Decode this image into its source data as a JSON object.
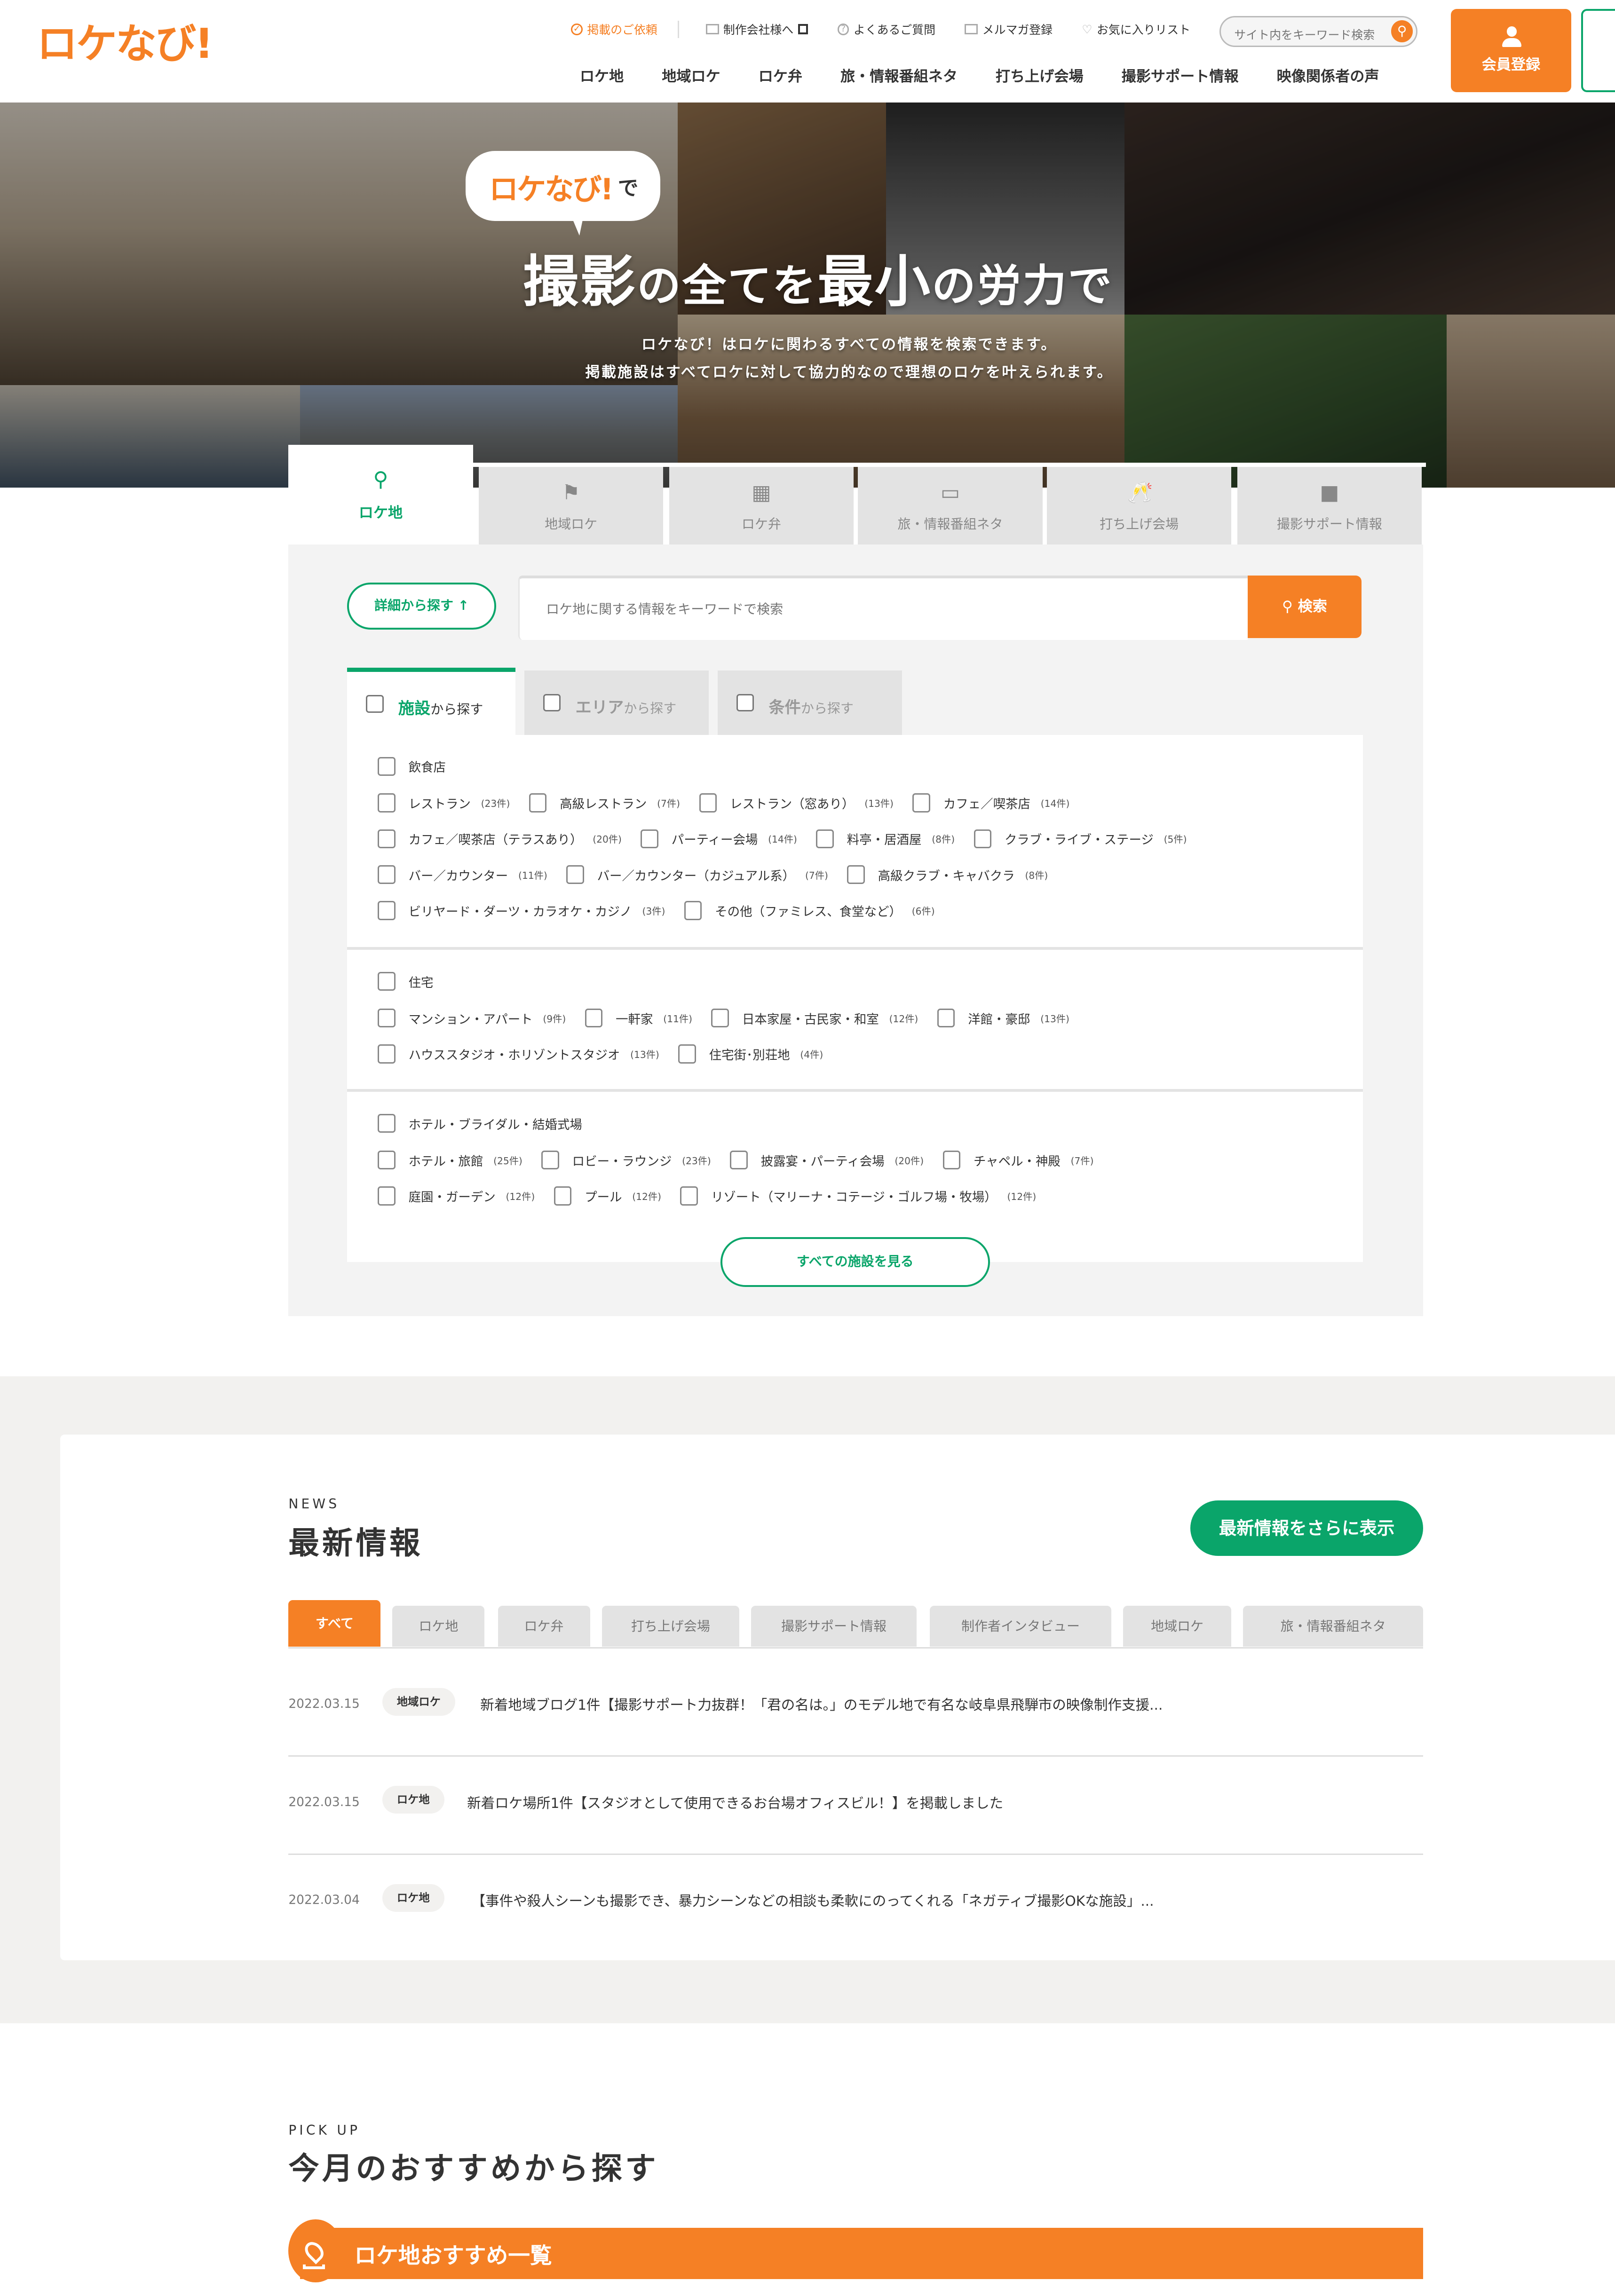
{
  "header": {
    "logo": "ロケなび!",
    "utility_links": [
      {
        "label": "掲載のご依頼",
        "icon": "check-circle-icon",
        "highlight": true
      },
      {
        "label": "制作会社様へ",
        "icon": "video-camera-icon",
        "external": true
      },
      {
        "label": "よくあるご質問",
        "icon": "question-circle-icon"
      },
      {
        "label": "メルマガ登録",
        "icon": "mail-icon"
      },
      {
        "label": "お気に入りリスト",
        "icon": "heart-icon"
      }
    ],
    "search_placeholder": "サイト内をキーワード検索",
    "main_nav": [
      "ロケ地",
      "地域ロケ",
      "ロケ弁",
      "旅・情報番組ネタ",
      "打ち上げ会場",
      "撮影サポート情報",
      "映像関係者の声"
    ],
    "register_label": "会員登録"
  },
  "hero": {
    "bubble_logo": "ロケなび!",
    "bubble_suffix": "で",
    "title_parts": [
      "撮影",
      "の全てを",
      "最小",
      "の労力で"
    ],
    "subtitle_lines": [
      "ロケなび！はロケに関わるすべての情報を検索できます。",
      "掲載施設はすべてロケに対して協力的なので理想のロケを叶えられます。"
    ]
  },
  "category_tabs": [
    {
      "label": "ロケ地",
      "icon": "map-pin-icon",
      "active": true
    },
    {
      "label": "地域ロケ",
      "icon": "map-flag-icon"
    },
    {
      "label": "ロケ弁",
      "icon": "bento-icon"
    },
    {
      "label": "旅・情報番組ネタ",
      "icon": "tv-icon"
    },
    {
      "label": "打ち上げ会場",
      "icon": "cheers-icon"
    },
    {
      "label": "撮影サポート情報",
      "icon": "video-camera-icon"
    }
  ],
  "search": {
    "detail_button": "詳細から探す ↑",
    "keyword_placeholder": "ロケ地に関する情報をキーワードで検索",
    "search_button": "検索",
    "sub_tabs": [
      {
        "accent": "施設",
        "rest": "から探す",
        "active": true
      },
      {
        "accent": "エリア",
        "rest": "から探す"
      },
      {
        "accent": "条件",
        "rest": "から探す"
      }
    ],
    "groups": [
      {
        "title": "飲食店",
        "rows": [
          [
            {
              "label": "レストラン",
              "count": "(23件)"
            },
            {
              "label": "高級レストラン",
              "count": "(7件)"
            },
            {
              "label": "レストラン（窓あり）",
              "count": "(13件)"
            },
            {
              "label": "カフェ／喫茶店",
              "count": "(14件)"
            }
          ],
          [
            {
              "label": "カフェ／喫茶店（テラスあり）",
              "count": "(20件)"
            },
            {
              "label": "パーティー会場",
              "count": "(14件)"
            },
            {
              "label": "料亭・居酒屋",
              "count": "(8件)"
            },
            {
              "label": "クラブ・ライブ・ステージ",
              "count": "(5件)"
            }
          ],
          [
            {
              "label": "バー／カウンター",
              "count": "(11件)"
            },
            {
              "label": "バー／カウンター（カジュアル系）",
              "count": "(7件)"
            },
            {
              "label": "高級クラブ・キャバクラ",
              "count": "(8件)"
            }
          ],
          [
            {
              "label": "ビリヤード・ダーツ・カラオケ・カジノ",
              "count": "(3件)"
            },
            {
              "label": "その他（ファミレス、食堂など）",
              "count": "(6件)"
            }
          ]
        ]
      },
      {
        "title": "住宅",
        "rows": [
          [
            {
              "label": "マンション・アパート",
              "count": "(9件)"
            },
            {
              "label": "一軒家",
              "count": "(11件)"
            },
            {
              "label": "日本家屋・古民家・和室",
              "count": "(12件)"
            },
            {
              "label": "洋館・豪邸",
              "count": "(13件)"
            }
          ],
          [
            {
              "label": "ハウススタジオ・ホリゾントスタジオ",
              "count": "(13件)"
            },
            {
              "label": "住宅街･別荘地",
              "count": "(4件)"
            }
          ]
        ]
      },
      {
        "title": "ホテル・ブライダル・結婚式場",
        "rows": [
          [
            {
              "label": "ホテル・旅館",
              "count": "(25件)"
            },
            {
              "label": "ロビー・ラウンジ",
              "count": "(23件)"
            },
            {
              "label": "披露宴・パーティ会場",
              "count": "(20件)"
            },
            {
              "label": "チャペル・神殿",
              "count": "(7件)"
            }
          ],
          [
            {
              "label": "庭園・ガーデン",
              "count": "(12件)"
            },
            {
              "label": "プール",
              "count": "(12件)"
            },
            {
              "label": "リゾート（マリーナ・コテージ・ゴルフ場・牧場）",
              "count": "(12件)"
            }
          ]
        ]
      }
    ],
    "all_button": "すべての施設を見る"
  },
  "news": {
    "eyebrow": "NEWS",
    "title": "最新情報",
    "more_button": "最新情報をさらに表示",
    "tabs": [
      "すべて",
      "ロケ地",
      "ロケ弁",
      "打ち上げ会場",
      "撮影サポート情報",
      "制作者インタビュー",
      "地域ロケ",
      "旅・情報番組ネタ"
    ],
    "items": [
      {
        "date": "2022.03.15",
        "category": "地域ロケ",
        "title": "新着地域ブログ1件【撮影サポート力抜群！「君の名は。」のモデル地で有名な岐阜県飛騨市の映像制作支援..."
      },
      {
        "date": "2022.03.15",
        "category": "ロケ地",
        "title": "新着ロケ場所1件【スタジオとして使用できるお台場オフィスビル！】を掲載しました"
      },
      {
        "date": "2022.03.04",
        "category": "ロケ地",
        "title": "【事件や殺人シーンも撮影でき、暴力シーンなどの相談も柔軟にのってくれる「ネガティブ撮影OKな施設」..."
      }
    ]
  },
  "pickup": {
    "eyebrow": "PICK UP",
    "title": "今月のおすすめから探す",
    "bar_label": "ロケ地おすすめ一覧"
  },
  "colors": {
    "brand_orange": "#f58025",
    "brand_green": "#0aa56a",
    "panel_gray": "#f3f3f3"
  }
}
